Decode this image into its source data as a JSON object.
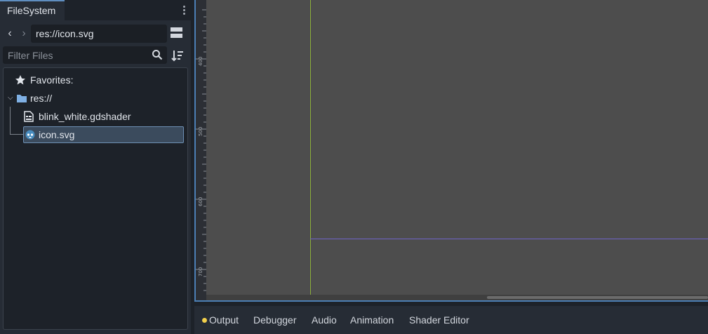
{
  "filesystem": {
    "tab_label": "FileSystem",
    "menu_icon": "vertical-dots-icon",
    "path_value": "res://icon.svg",
    "filter_placeholder": "Filter Files",
    "tree": {
      "favorites_label": "Favorites:",
      "root_label": "res://",
      "files": [
        "blink_white.gdshader",
        "icon.svg"
      ],
      "selected": "icon.svg"
    }
  },
  "viewport": {
    "ruler_labels": [
      "400",
      "500",
      "600",
      "700"
    ],
    "guide_color": "#8bae3a",
    "guide_h_color": "#6f64c8"
  },
  "bottom_panel": {
    "tabs": [
      "Output",
      "Debugger",
      "Audio",
      "Animation",
      "Shader Editor"
    ],
    "output_indicator_color": "#f2d04b"
  }
}
